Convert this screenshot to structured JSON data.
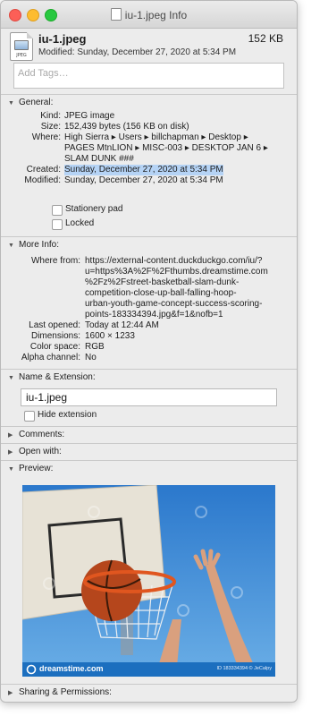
{
  "window": {
    "title": "iu-1.jpeg Info"
  },
  "header": {
    "icon_ext": "JPEG",
    "file_name": "iu-1.jpeg",
    "file_size": "152 KB",
    "modified": "Modified: Sunday, December 27, 2020 at 5:34 PM"
  },
  "tags": {
    "placeholder": "Add Tags…"
  },
  "general": {
    "title": "General:",
    "kind_label": "Kind:",
    "kind": "JPEG image",
    "size_label": "Size:",
    "size": "152,439 bytes (156 KB on disk)",
    "where_label": "Where:",
    "where_lines": [
      "High Sierra ▸ Users ▸ billchapman ▸ Desktop ▸",
      "PAGES MtnLION ▸ MISC-003 ▸ DESKTOP JAN 6 ▸",
      "SLAM DUNK ###"
    ],
    "created_label": "Created:",
    "created": "Sunday, December 27, 2020 at 5:34 PM",
    "modified_label": "Modified:",
    "modified": "Sunday, December 27, 2020 at 5:34 PM",
    "stationery_label": "Stationery pad",
    "locked_label": "Locked"
  },
  "more_info": {
    "title": "More Info:",
    "where_from_label": "Where from:",
    "where_from_lines": [
      "https://external-content.duckduckgo.com/iu/?",
      "u=https%3A%2F%2Fthumbs.dreamstime.com",
      "%2Fz%2Fstreet-basketball-slam-dunk-",
      "competition-close-up-ball-falling-hoop-",
      "urban-youth-game-concept-success-scoring-",
      "points-183334394.jpg&f=1&nofb=1"
    ],
    "last_opened_label": "Last opened:",
    "last_opened": "Today at 12:44 AM",
    "dimensions_label": "Dimensions:",
    "dimensions": "1600 × 1233",
    "color_space_label": "Color space:",
    "color_space": "RGB",
    "alpha_label": "Alpha channel:",
    "alpha": "No"
  },
  "name_ext": {
    "title": "Name & Extension:",
    "value": "iu-1.jpeg",
    "hide_ext_label": "Hide extension"
  },
  "comments": {
    "title": "Comments:"
  },
  "open_with": {
    "title": "Open with:"
  },
  "preview": {
    "title": "Preview:",
    "watermark_brand": "dreamstime.com",
    "watermark_id": "ID 183334394 © JeCalpy",
    "colors": {
      "sky": "#2f7fd2",
      "board": "#e7e2d6",
      "rim": "#e0561f",
      "ball": "#b5461c",
      "footer": "#1c6fbf"
    }
  },
  "sharing": {
    "title": "Sharing & Permissions:"
  }
}
